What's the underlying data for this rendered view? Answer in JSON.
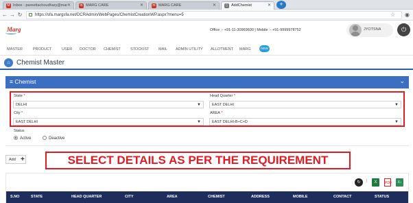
{
  "browser": {
    "tabs": [
      {
        "label": "Inbox - pareettachoudhary@mar",
        "fav": "M",
        "fav_color": "#d93025"
      },
      {
        "label": "MARG CARE",
        "fav": "m",
        "fav_color": "#c0392b"
      },
      {
        "label": "MARG CARE",
        "fav": "m",
        "fav_color": "#c0392b"
      },
      {
        "label": "AddChemist",
        "fav": "▯",
        "fav_color": "#777777"
      }
    ],
    "url": "https://sfa.margsfa.net/DCRAdmin/WebPages/ChemistCreationWP.aspx?menu=5"
  },
  "header": {
    "logo": "Marg",
    "contact": "Office :- +91-11-30969600  |  Mobile :- +91-9999978752",
    "user_name": "JYOTSNA"
  },
  "nav": {
    "items": [
      "MASTER",
      "PRODUCT",
      "USER",
      "DOCTOR",
      "CHEMIST",
      "STOCKIST",
      "MAIL",
      "ADMIN UTILITY",
      "ALLOTMENT",
      "MARG"
    ],
    "badge": "NEW"
  },
  "page": {
    "title": "Chemist Master"
  },
  "panel": {
    "title": "Chemist"
  },
  "form": {
    "state_label": "State",
    "state_value": "DELHI",
    "hq_label": "Head Quarter",
    "hq_value": "EAST DELHI",
    "city_label": "City",
    "city_value": "EAST DELHI",
    "area_label": "AREA",
    "area_value": "EAST DELHI-B+C+D",
    "required_mark": "*",
    "status_label": "Status",
    "status_active": "Active",
    "status_deactive": "Deactive",
    "selected_status": "Active"
  },
  "actions": {
    "add_label": "Add",
    "add_icon": "+"
  },
  "callout": "SELECT DETAILS AS PER THE REQUIREMENT",
  "grid": {
    "columns": [
      "S.NO",
      "STATE",
      "HEAD QUARTER",
      "CITY",
      "AREA",
      "CHEMIST",
      "ADDRESS",
      "MOBILE",
      "CONTACT",
      "STATUS"
    ]
  },
  "colors": {
    "accent": "#3b6fc4",
    "highlight": "#e21b23",
    "table_header": "#1f2d5c"
  }
}
